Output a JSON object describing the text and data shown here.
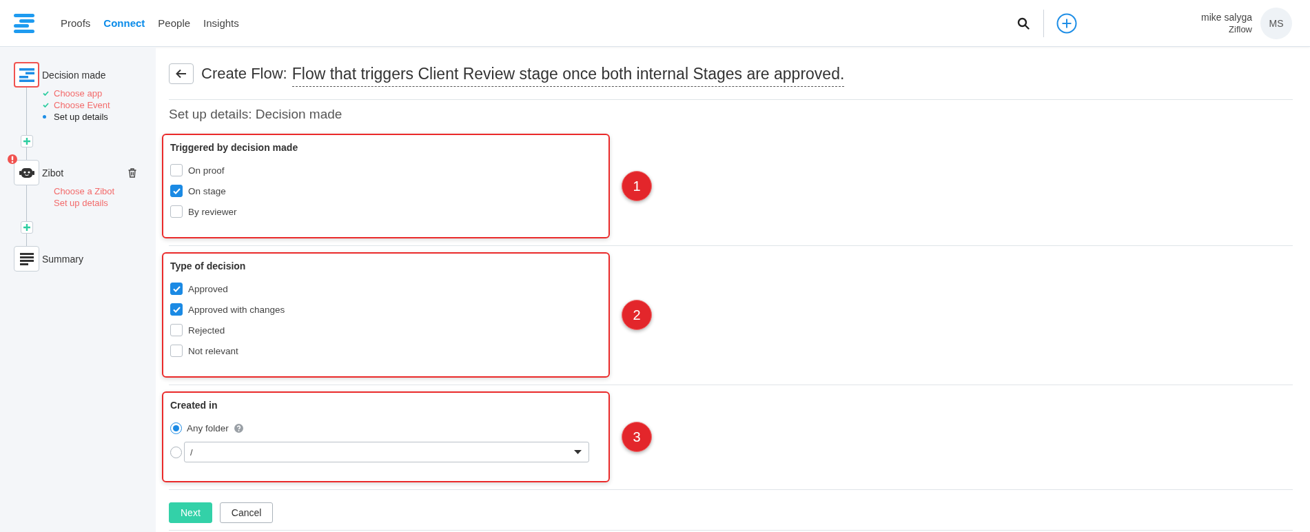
{
  "header": {
    "nav": [
      {
        "label": "Proofs",
        "selected": false
      },
      {
        "label": "Connect",
        "selected": true
      },
      {
        "label": "People",
        "selected": false
      },
      {
        "label": "Insights",
        "selected": false
      }
    ],
    "user": {
      "name": "mike salyga",
      "org": "Ziflow",
      "initials": "MS"
    }
  },
  "sidebar": {
    "steps": [
      {
        "kind": "trigger",
        "title": "Decision made",
        "active": true,
        "warning": false,
        "deletable": false,
        "substeps": [
          {
            "label": "Choose app",
            "kind": "done"
          },
          {
            "label": "Choose Event",
            "kind": "done"
          },
          {
            "label": "Set up details",
            "kind": "current"
          }
        ]
      },
      {
        "kind": "bot",
        "title": "Zibot",
        "active": false,
        "warning": true,
        "deletable": true,
        "substeps": [
          {
            "label": "Choose a Zibot",
            "kind": "todo"
          },
          {
            "label": "Set up details",
            "kind": "todo"
          }
        ]
      },
      {
        "kind": "summary",
        "title": "Summary",
        "active": false,
        "warning": false,
        "deletable": false
      }
    ]
  },
  "page": {
    "title_prefix": "Create Flow:",
    "flow_name": "Flow that triggers Client Review stage once both internal Stages are approved.",
    "subtitle": "Set up details: Decision made"
  },
  "sections": [
    {
      "number": "1",
      "kind": "checkboxes",
      "title": "Triggered by decision made",
      "options": [
        {
          "label": "On proof",
          "checked": false
        },
        {
          "label": "On stage",
          "checked": true
        },
        {
          "label": "By reviewer",
          "checked": false
        }
      ]
    },
    {
      "number": "2",
      "kind": "checkboxes",
      "title": "Type of decision",
      "options": [
        {
          "label": "Approved",
          "checked": true
        },
        {
          "label": "Approved with changes",
          "checked": true
        },
        {
          "label": "Rejected",
          "checked": false
        },
        {
          "label": "Not relevant",
          "checked": false
        }
      ]
    },
    {
      "number": "3",
      "kind": "radios",
      "title": "Created in",
      "options": [
        {
          "kind": "plain",
          "label": "Any folder",
          "help": true,
          "selected": true
        },
        {
          "kind": "select",
          "value": "/",
          "selected": false
        }
      ]
    }
  ],
  "buttons": [
    {
      "label": "Next",
      "kind": "primary"
    },
    {
      "label": "Cancel",
      "kind": "secondary"
    }
  ]
}
